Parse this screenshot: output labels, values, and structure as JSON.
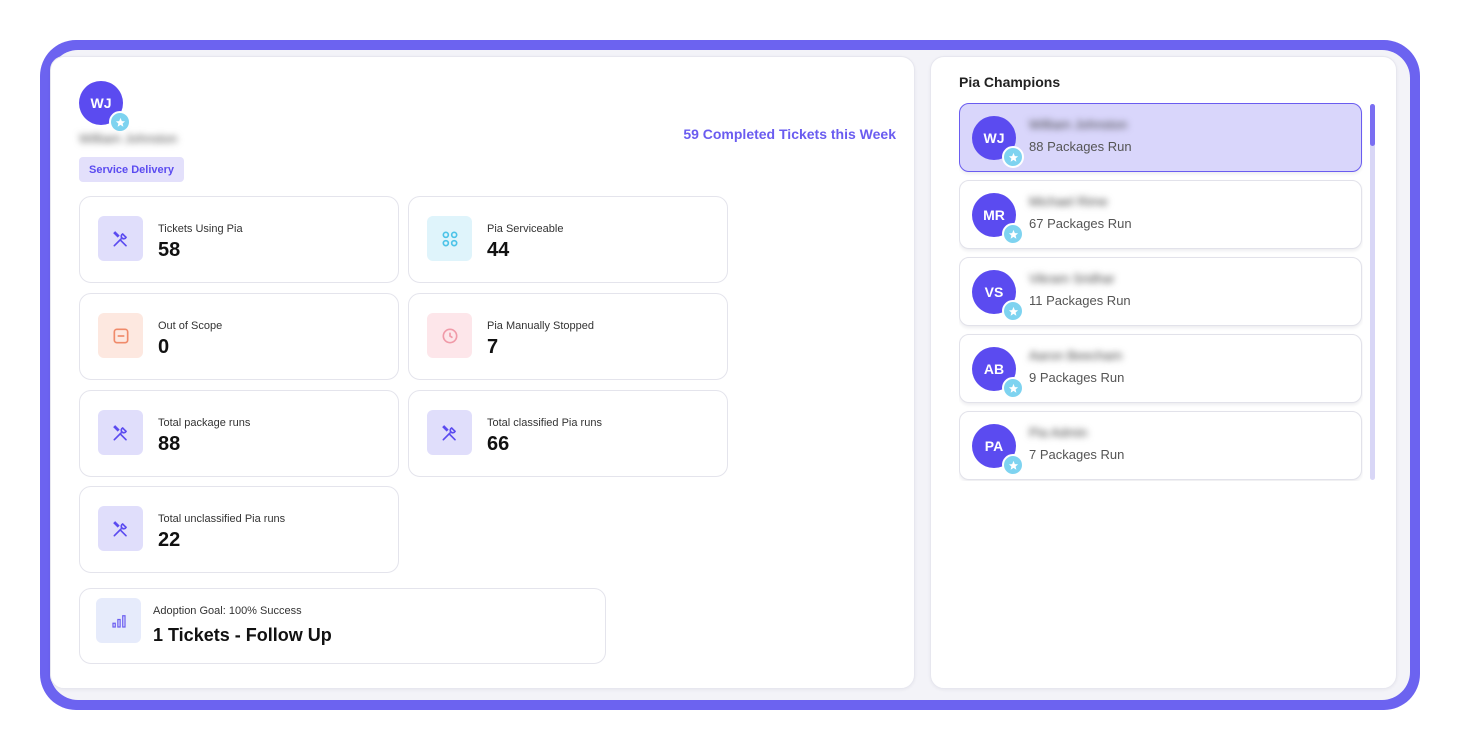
{
  "user": {
    "initials": "WJ",
    "name": "William Johnston",
    "department": "Service Delivery",
    "completed_tickets": "59 Completed Tickets this Week"
  },
  "stats": [
    {
      "label": "Tickets Using Pia",
      "value": "58",
      "icon": "tools-icon",
      "color": "#e0defb"
    },
    {
      "label": "Pia Serviceable",
      "value": "44",
      "icon": "grid-circles-icon",
      "color": "#dff4fb"
    },
    {
      "label": "Out of Scope",
      "value": "0",
      "icon": "minus-box-icon",
      "color": "#fde8e0"
    },
    {
      "label": "Pia Manually Stopped",
      "value": "7",
      "icon": "clock-icon",
      "color": "#fde6ea"
    },
    {
      "label": "Total package runs",
      "value": "88",
      "icon": "tools-icon",
      "color": "#e0defb"
    },
    {
      "label": "Total classified Pia runs",
      "value": "66",
      "icon": "tools-icon",
      "color": "#e0defb"
    },
    {
      "label": "Total unclassified Pia runs",
      "value": "22",
      "icon": "tools-icon",
      "color": "#e0defb"
    }
  ],
  "goal": {
    "label": "Adoption Goal: 100% Success",
    "value": "1 Tickets - Follow Up",
    "icon": "bar-chart-icon"
  },
  "champions": {
    "title": "Pia Champions",
    "items": [
      {
        "initials": "WJ",
        "name": "William Johnston",
        "runs": "88 Packages Run"
      },
      {
        "initials": "MR",
        "name": "Michael Rime",
        "runs": "67 Packages Run"
      },
      {
        "initials": "VS",
        "name": "Vikram Sridhar",
        "runs": "11 Packages Run"
      },
      {
        "initials": "AB",
        "name": "Aaron Beecham",
        "runs": "9 Packages Run"
      },
      {
        "initials": "PA",
        "name": "Pia Admin",
        "runs": "7 Packages Run"
      }
    ]
  },
  "colors": {
    "accent": "#6a5cf0",
    "avatar": "#5b4bf0",
    "frame": "#6c63f0",
    "star_badge": "#7ed3f0"
  }
}
